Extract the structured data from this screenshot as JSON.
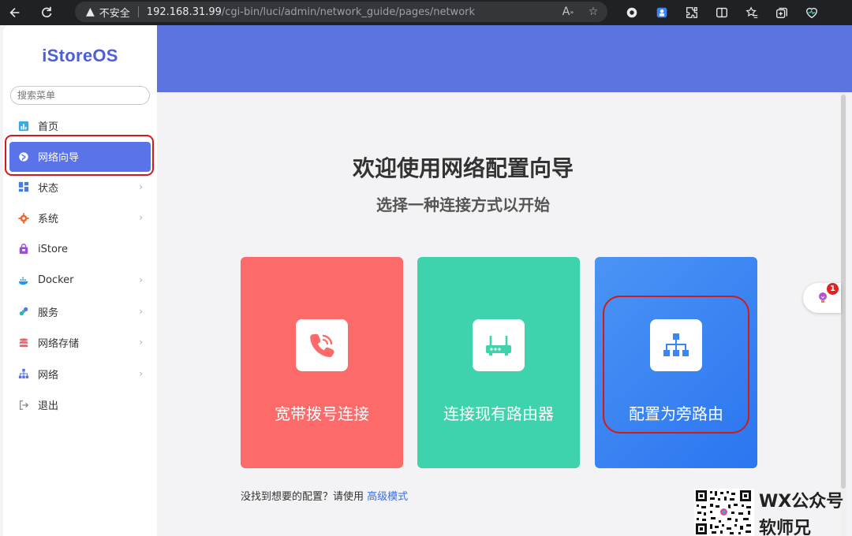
{
  "browser": {
    "insecure_label": "不安全",
    "url_host": "192.168.31.99",
    "url_path": "/cgi-bin/luci/admin/network_guide/pages/network"
  },
  "sidebar": {
    "brand": "iStoreOS",
    "search_placeholder": "搜索菜单",
    "items": [
      {
        "label": "首页",
        "icon": "dashboard-icon",
        "has_children": false
      },
      {
        "label": "网络向导",
        "icon": "globe-icon",
        "has_children": false,
        "active": true
      },
      {
        "label": "状态",
        "icon": "grid-icon",
        "has_children": true
      },
      {
        "label": "系统",
        "icon": "gear-icon",
        "has_children": true
      },
      {
        "label": "iStore",
        "icon": "store-bag-icon",
        "has_children": false
      },
      {
        "label": "Docker",
        "icon": "docker-whale-icon",
        "has_children": true
      },
      {
        "label": "服务",
        "icon": "puzzle-icon",
        "has_children": true
      },
      {
        "label": "网络存储",
        "icon": "database-icon",
        "has_children": true
      },
      {
        "label": "网络",
        "icon": "network-tree-icon",
        "has_children": true
      },
      {
        "label": "退出",
        "icon": "logout-icon",
        "has_children": false
      }
    ]
  },
  "guide": {
    "title": "欢迎使用网络配置向导",
    "subtitle": "选择一种连接方式以开始",
    "cards": [
      {
        "label": "宽带拨号连接",
        "icon": "phone-icon",
        "color": "#fd6a6a"
      },
      {
        "label": "连接现有路由器",
        "icon": "router-icon",
        "color": "#3ed3ad"
      },
      {
        "label": "配置为旁路由",
        "icon": "topology-icon",
        "color": "#2b75f0"
      }
    ],
    "footer_text": "没找到想要的配置？请使用",
    "footer_link": "高级模式"
  },
  "help": {
    "badge": "1"
  },
  "watermark": {
    "line1": "WX公众号",
    "line2": "软师兄"
  },
  "colors": {
    "accent": "#5b73e8",
    "highlight_outline": "#d11a1a",
    "banner": "#5d73e0"
  }
}
